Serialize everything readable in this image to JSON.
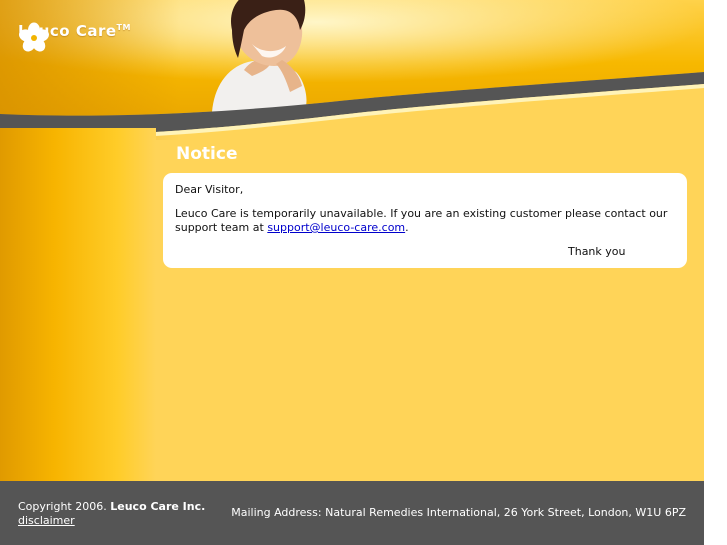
{
  "brand": {
    "name": "Leuco Care",
    "trademark": "TM"
  },
  "notice": {
    "title": "Notice",
    "greeting": "Dear Visitor,",
    "message_before_link": "Leuco Care is temporarily unavailable. If you are an existing customer please contact our support team at ",
    "support_email": "support@leuco-care.com",
    "message_after_link": ".",
    "sign_off": "Thank you"
  },
  "footer": {
    "copyright_prefix": "Copyright 2006.",
    "company": "Leuco Care Inc.",
    "disclaimer_label": "disclaimer",
    "mailing_address": "Mailing Address: Natural Remedies International, 26 York Street, London, W1U 6PZ"
  },
  "colors": {
    "page_background": "#ffd458",
    "header_gold": "#f6b800",
    "swoosh_gray": "#555555",
    "footer_gray": "#555555",
    "link_blue": "#0000cc"
  },
  "icons": {
    "logo": "flower-icon"
  }
}
